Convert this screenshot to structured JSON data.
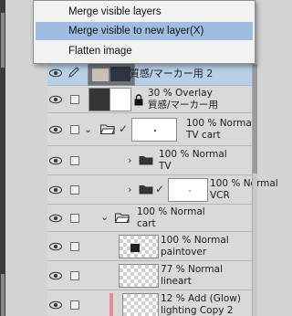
{
  "menu": {
    "items": [
      {
        "label": "Merge visible layers"
      },
      {
        "label": "Merge visible to new layer(X)",
        "highlighted": true
      },
      {
        "label": "Flatten image"
      }
    ]
  },
  "layers": [
    {
      "name": "質感/マーカー用 2",
      "blend": "",
      "selected": true
    },
    {
      "blend": "30 % Overlay",
      "name": "質感/マーカー用"
    },
    {
      "blend": "100 % Normal",
      "name": "TV cart",
      "type": "folder",
      "expanded": true
    },
    {
      "blend": "100 % Normal",
      "name": "TV",
      "type": "folder",
      "expanded": false
    },
    {
      "blend": "100 % Normal",
      "name": "VCR",
      "type": "folder",
      "expanded": false
    },
    {
      "blend": "100 % Normal",
      "name": "cart",
      "type": "folder",
      "expanded": true
    },
    {
      "blend": "100 % Normal",
      "name": "paintover"
    },
    {
      "blend": "77 % Normal",
      "name": "lineart"
    },
    {
      "blend": "12 % Add (Glow)",
      "name": "lighting Copy 2"
    }
  ],
  "colors": {
    "menu_highlight": "#9fbde0",
    "selected_row": "#b8cfe8",
    "color_label_pink": "#e88a9a"
  }
}
